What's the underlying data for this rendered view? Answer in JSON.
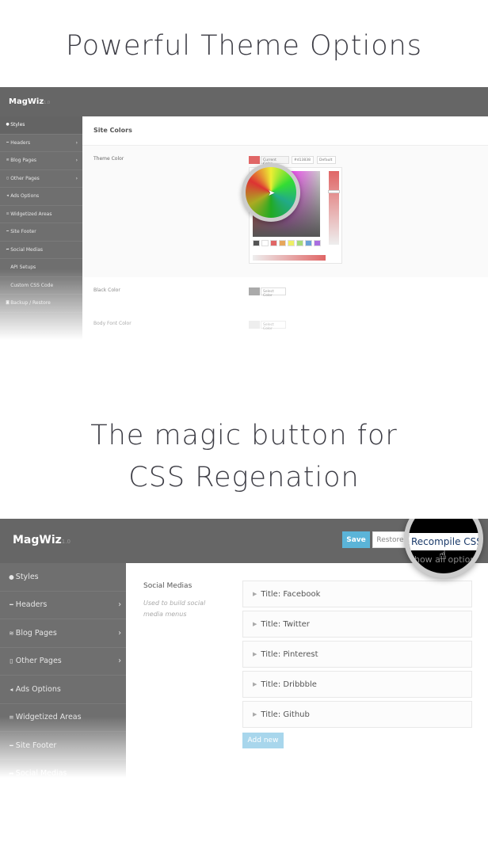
{
  "heading1": "Powerful Theme Options",
  "heading2_line1": "The magic button for",
  "heading2_line2": "CSS Regenation",
  "screen1": {
    "logo": "MagWiz",
    "version": "1.0",
    "sidebar": [
      {
        "label": "Styles",
        "icon": "drop-icon",
        "active": true
      },
      {
        "label": "Headers",
        "icon": "minus-icon",
        "chevron": true
      },
      {
        "label": "Blog Pages",
        "icon": "rss-icon",
        "chevron": true
      },
      {
        "label": "Other Pages",
        "icon": "file-icon",
        "chevron": true
      },
      {
        "label": "Ads Options",
        "icon": "bullhorn-icon"
      },
      {
        "label": "Widgetized Areas",
        "icon": "list-icon"
      },
      {
        "label": "Site Footer",
        "icon": "minus-icon"
      },
      {
        "label": "Social Medias",
        "icon": "share-icon"
      },
      {
        "label": "API Setups",
        "icon": "code-icon"
      },
      {
        "label": "Custom CSS Code",
        "icon": "code-icon"
      },
      {
        "label": "Backup / Restore",
        "icon": "shield-icon"
      }
    ],
    "section_title": "Site Colors",
    "theme_color_label": "Theme Color",
    "current_color_label": "Current Color",
    "hex_value": "#d13838",
    "default_label": "Default",
    "black_color_label": "Black Color",
    "body_font_color_label": "Body Font Color",
    "select_color_label": "Select Color",
    "swatches": [
      "#555555",
      "#ffffff",
      "#e06666",
      "#e6a65c",
      "#eeee66",
      "#a6d97a",
      "#6aa1d8",
      "#a96ee0"
    ],
    "theme_color": "#e06666"
  },
  "screen2": {
    "logo": "MagWiz",
    "version": "1.0",
    "save_label": "Save",
    "restore_label": "Restore",
    "recompile_label": "Recompile CSS",
    "show_options_label": "Show all options",
    "sidebar": [
      {
        "label": "Styles",
        "icon": "drop-icon"
      },
      {
        "label": "Headers",
        "icon": "minus-icon",
        "chevron": true
      },
      {
        "label": "Blog Pages",
        "icon": "rss-icon",
        "chevron": true
      },
      {
        "label": "Other Pages",
        "icon": "file-icon",
        "chevron": true
      },
      {
        "label": "Ads Options",
        "icon": "bullhorn-icon"
      },
      {
        "label": "Widgetized Areas",
        "icon": "list-icon"
      },
      {
        "label": "Site Footer",
        "icon": "minus-icon"
      },
      {
        "label": "Social Medias",
        "icon": "share-icon",
        "active": true
      }
    ],
    "section_title": "Social Medias",
    "section_desc": "Used to build social media menus",
    "items": [
      "Title: Facebook",
      "Title: Twitter",
      "Title: Pinterest",
      "Title: Dribbble",
      "Title: Github"
    ],
    "add_new_label": "Add new",
    "save_color": "#5bb4d8"
  }
}
